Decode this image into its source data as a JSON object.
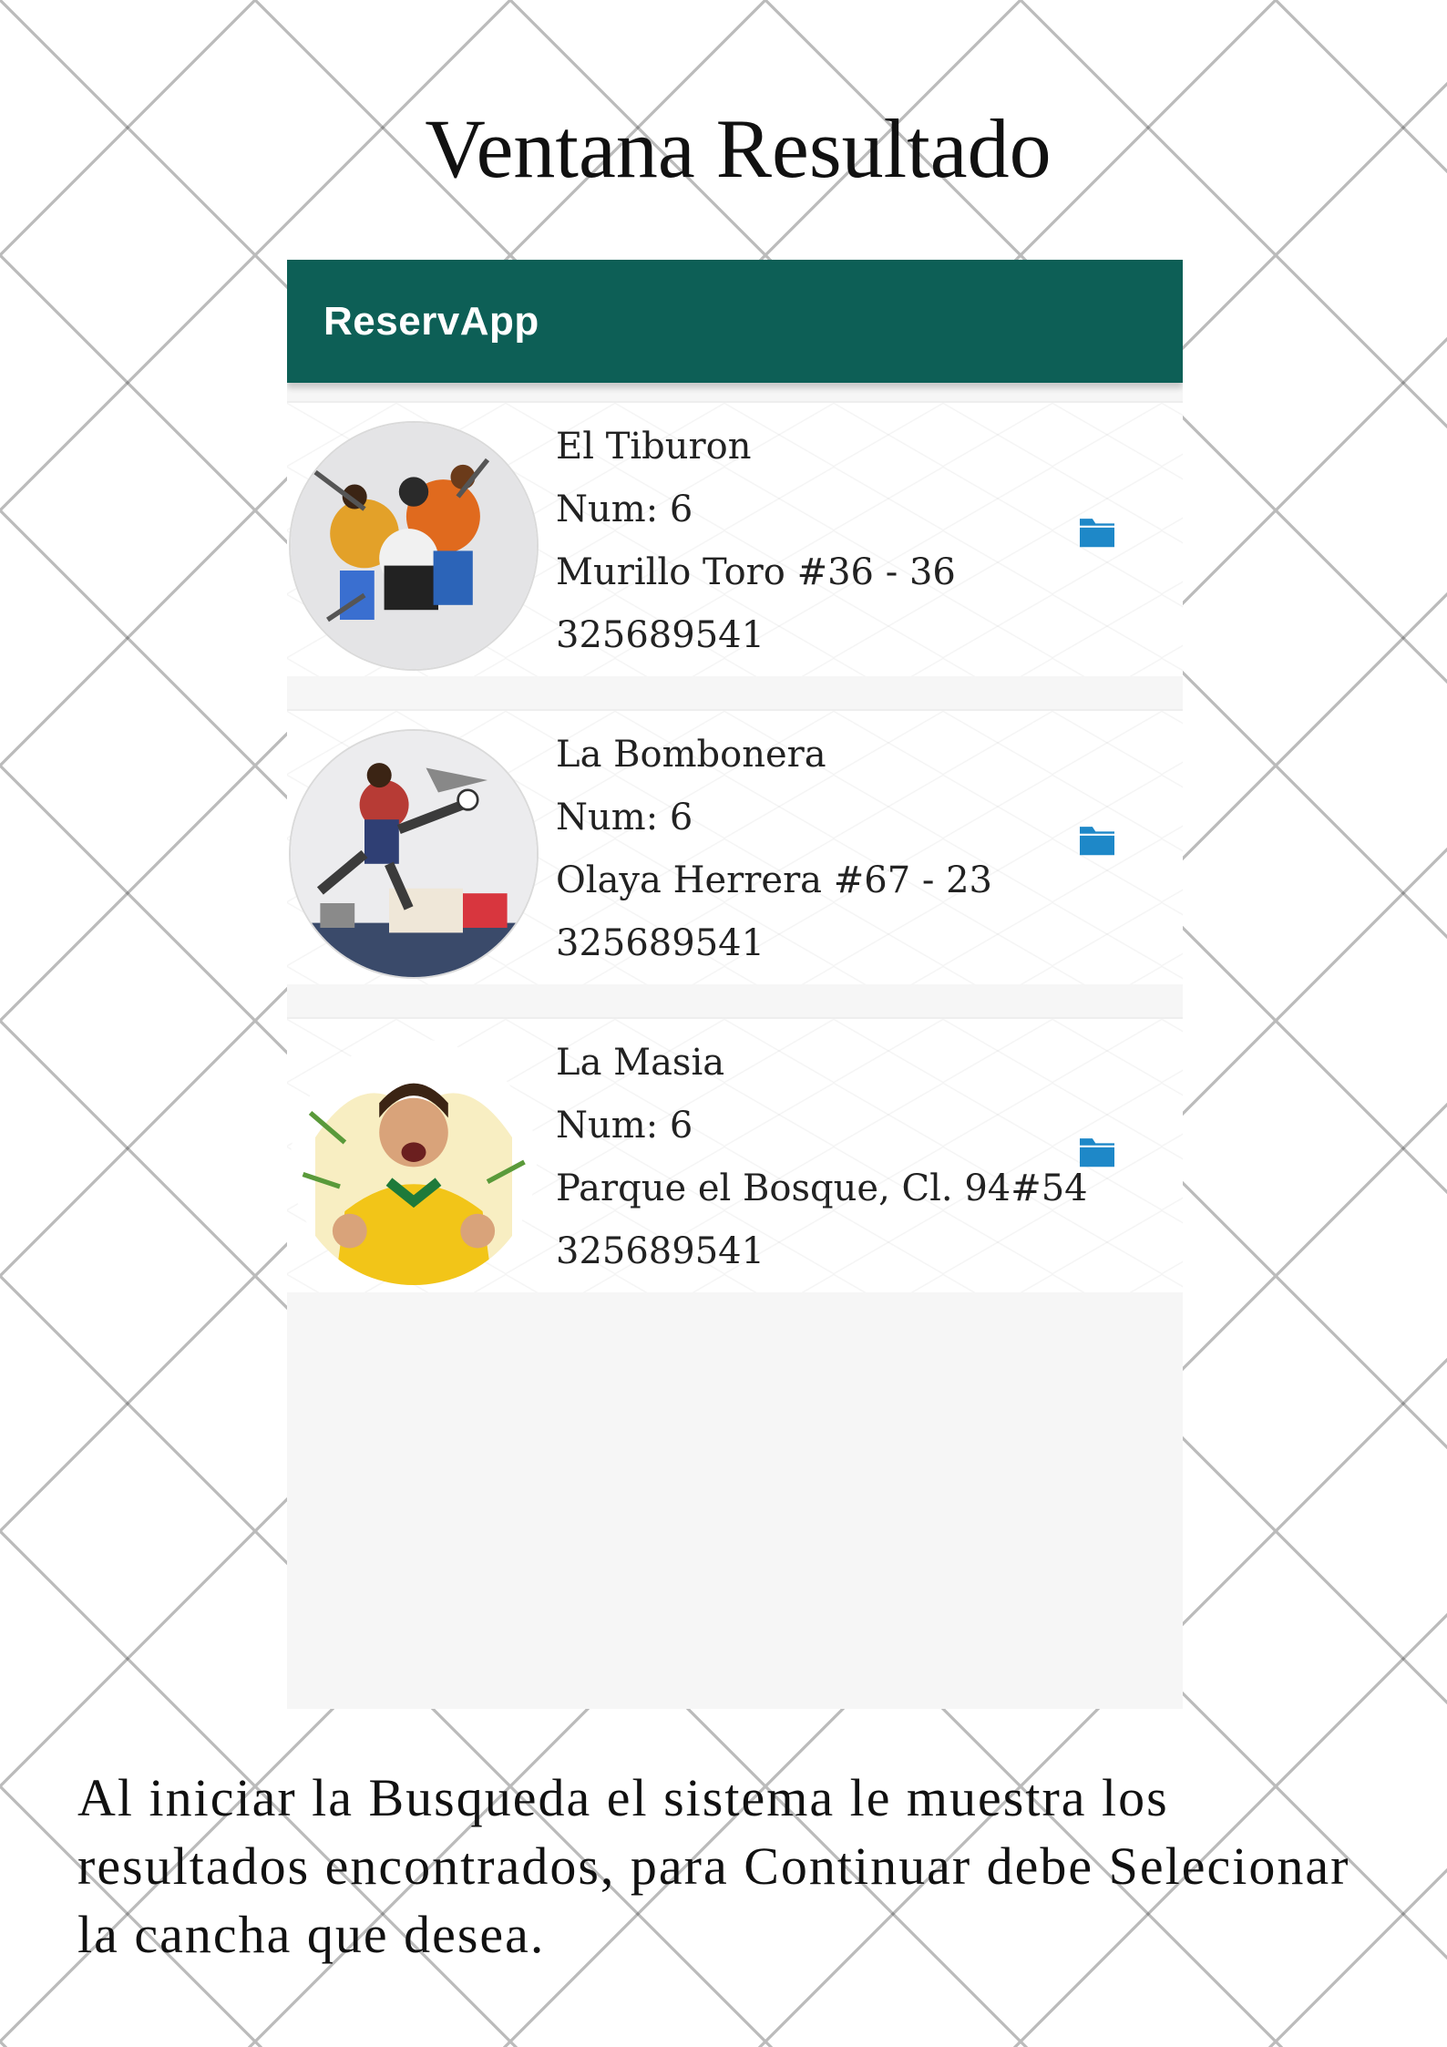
{
  "page": {
    "title": "Ventana Resultado",
    "description": "Al iniciar la Busqueda el sistema le muestra los resultados encontrados, para Continuar debe Selecionar la cancha que desea."
  },
  "app": {
    "name": "ReservApp",
    "bar_color": "#0d5f56"
  },
  "results": [
    {
      "name": "El Tiburon",
      "num": "Num: 6",
      "address": "Murillo Toro #36 - 36",
      "phone": "325689541",
      "image": "soccer-players-collage",
      "action_icon": "folder-icon"
    },
    {
      "name": "La Bombonera",
      "num": "Num: 6",
      "address": "Olaya Herrera #67 - 23",
      "phone": "325689541",
      "image": "soccer-kick-mural",
      "action_icon": "folder-icon"
    },
    {
      "name": "La Masia",
      "num": "Num: 6",
      "address": "Parque el Bosque, Cl. 94#54",
      "phone": "325689541",
      "image": "player-celebrating-yellow-shirt",
      "action_icon": "folder-icon"
    }
  ],
  "icon_color": "#1e88c8"
}
